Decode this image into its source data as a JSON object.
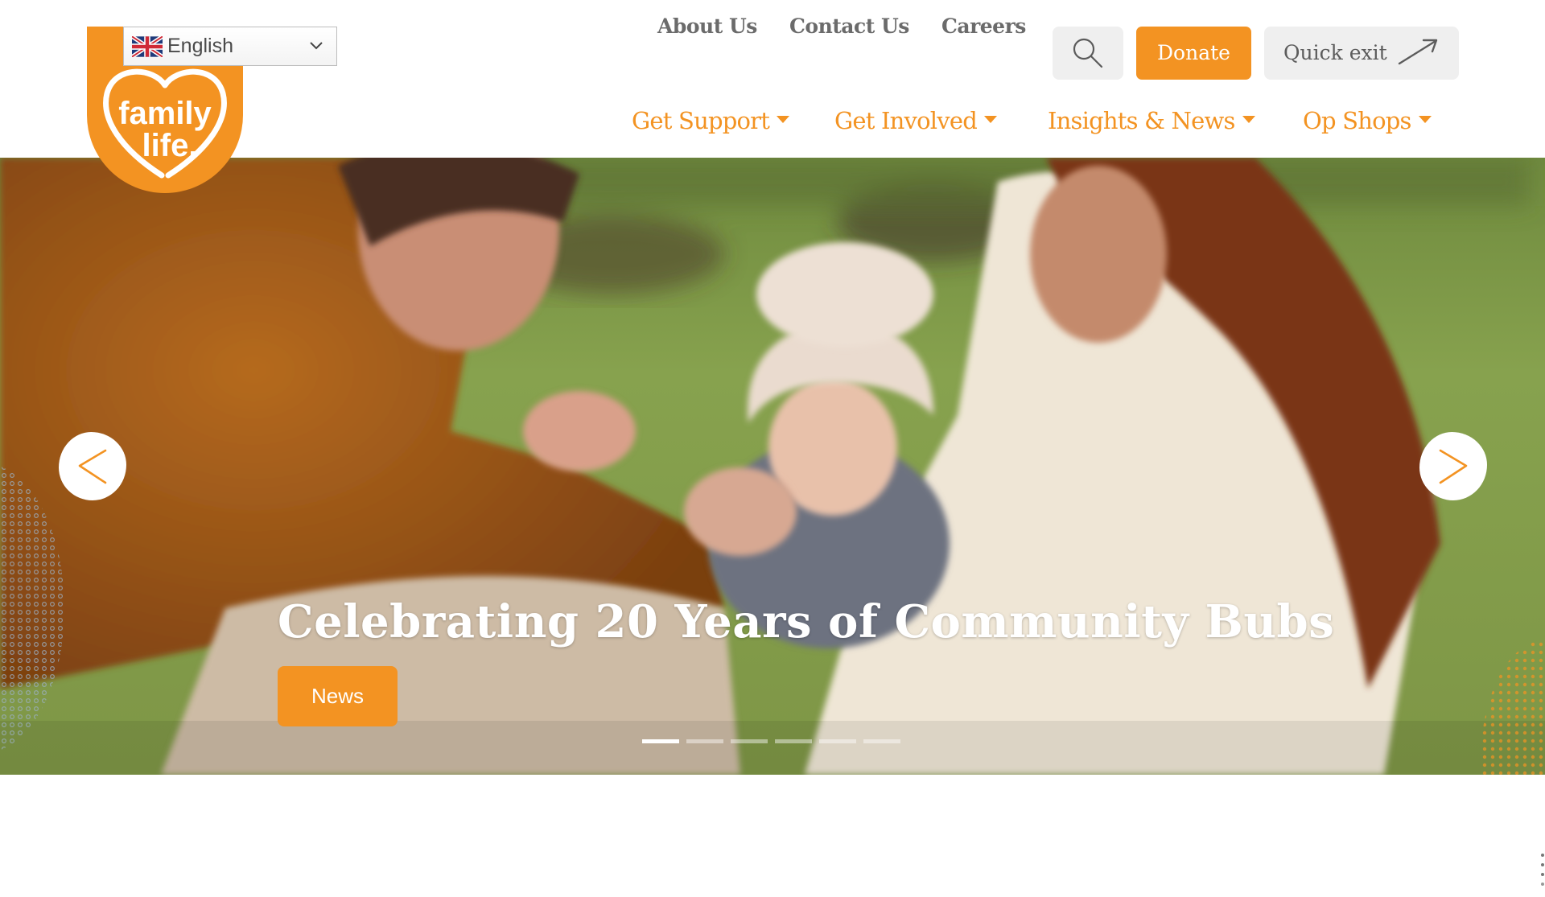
{
  "brand": {
    "name_line1": "family",
    "name_line2": "life.",
    "accent_color": "#f39322",
    "text_gray": "#6b6b6b"
  },
  "language": {
    "selected": "English",
    "flag_icon": "uk-flag-icon",
    "chevron_icon": "chevron-down-icon"
  },
  "utility_nav": {
    "items": [
      {
        "label": "About Us"
      },
      {
        "label": "Contact Us"
      },
      {
        "label": "Careers"
      }
    ],
    "search_icon": "search-icon",
    "donate_label": "Donate",
    "quick_exit_label": "Quick exit",
    "quick_exit_icon": "arrow-up-right-icon"
  },
  "main_nav": {
    "items": [
      {
        "label": "Get Support",
        "has_dropdown": true
      },
      {
        "label": "Get Involved",
        "has_dropdown": true
      },
      {
        "label": "Insights & News",
        "has_dropdown": true
      },
      {
        "label": "Op Shops",
        "has_dropdown": true
      }
    ]
  },
  "hero": {
    "slide_title": "Celebrating 20 Years of Community Bubs",
    "tag_label": "News",
    "prev_icon": "chevron-left-icon",
    "next_icon": "chevron-right-icon",
    "slide_count": 6,
    "active_slide": 1,
    "image_description": "Father and mother playing with baby wearing a bow headwrap on grass"
  }
}
